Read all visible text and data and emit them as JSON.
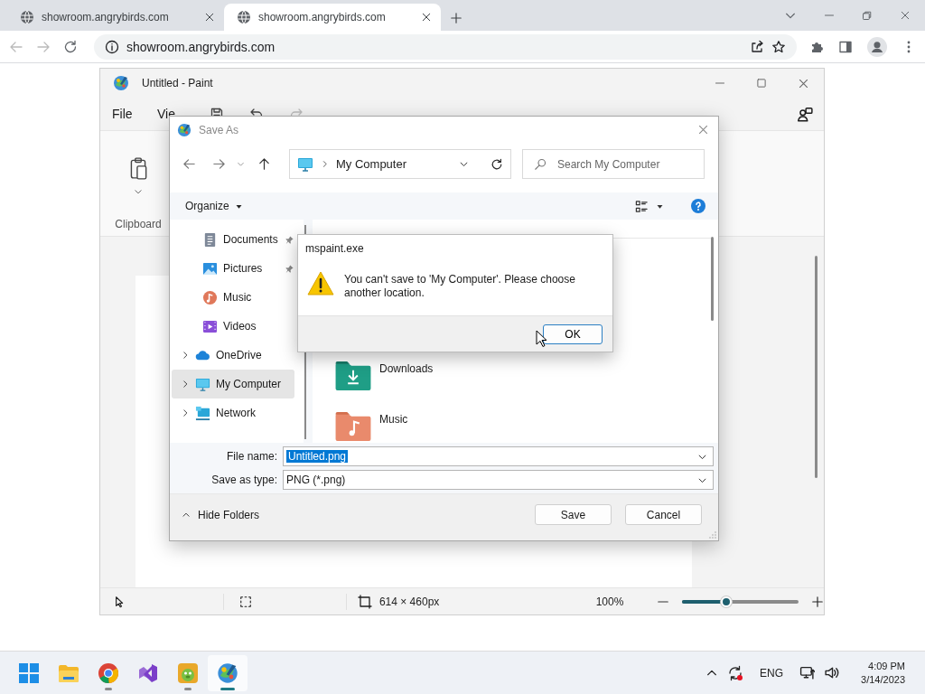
{
  "browser": {
    "tabs": [
      {
        "title": "showroom.angrybirds.com",
        "selected": false
      },
      {
        "title": "showroom.angrybirds.com",
        "selected": true
      }
    ],
    "address": "showroom.angrybirds.com"
  },
  "paint": {
    "title": "Untitled - Paint",
    "menu": [
      "File",
      "Vie"
    ],
    "ribbon_group": "Clipboard",
    "canvas_size": "614 × 460px",
    "zoom": "100%",
    "zoom_slider": {
      "level": 0.38
    }
  },
  "save_dialog": {
    "title": "Save As",
    "location": "My Computer",
    "search_placeholder": "Search My Computer",
    "organize": "Organize",
    "nav": [
      {
        "label": "Documents",
        "kind": "documents",
        "pinned": true,
        "expandable": false,
        "selected": false
      },
      {
        "label": "Pictures",
        "kind": "pictures",
        "pinned": true,
        "expandable": false,
        "selected": false
      },
      {
        "label": "Music",
        "kind": "music",
        "pinned": false,
        "expandable": false,
        "selected": false
      },
      {
        "label": "Videos",
        "kind": "videos",
        "pinned": false,
        "expandable": false,
        "selected": false
      },
      {
        "label": "OneDrive",
        "kind": "cloud",
        "pinned": false,
        "expandable": true,
        "selected": false
      },
      {
        "label": "My Computer",
        "kind": "computer",
        "pinned": false,
        "expandable": true,
        "selected": true
      },
      {
        "label": "Network",
        "kind": "network",
        "pinned": false,
        "expandable": true,
        "selected": false
      }
    ],
    "folders": [
      {
        "name": "Downloads",
        "kind": "downloads"
      },
      {
        "name": "Music",
        "kind": "music"
      }
    ],
    "file_name_label": "File name:",
    "file_name": "Untitled.png",
    "type_label": "Save as type:",
    "type": "PNG (*.png)",
    "hide_folders": "Hide Folders",
    "buttons": [
      "Save",
      "Cancel"
    ]
  },
  "message_box": {
    "title": "mspaint.exe",
    "message": "You can't save to 'My Computer'. Please choose another location.",
    "button": "OK"
  },
  "taskbar": {
    "apps": [
      {
        "kind": "start",
        "running": false,
        "active": false
      },
      {
        "kind": "explorer",
        "running": false,
        "active": false
      },
      {
        "kind": "browser",
        "running": true,
        "active": false
      },
      {
        "kind": "studio",
        "running": false,
        "active": false
      },
      {
        "kind": "game",
        "running": true,
        "active": false
      },
      {
        "kind": "paint",
        "running": true,
        "active": true
      }
    ],
    "language": "ENG",
    "time": "4:09 PM",
    "date": "3/14/2023"
  }
}
